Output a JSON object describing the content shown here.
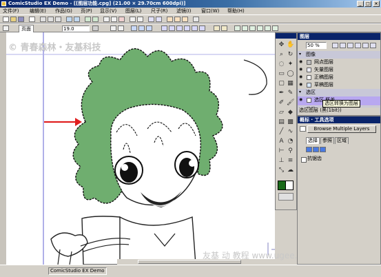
{
  "window": {
    "title": "ComicStudio EX Demo - [[图层功能.cpg] (21.00 × 29.70cm 600dpi)]",
    "minimize": "_",
    "maximize": "□",
    "close": "×"
  },
  "menu": [
    "文件(F)",
    "编辑(E)",
    "作品(G)",
    "页(P)",
    "显示(V)",
    "图层(L)",
    "尺子(R)",
    "滤镜(I)",
    "窗口(W)",
    "帮助(H)"
  ],
  "toolbar": {
    "zoom_value": "19.0",
    "page_tab": "页面"
  },
  "watermarks": {
    "top_left": "© 青春森林・友基科技",
    "bottom_right": "友基 动 教程  www.ugee.com.cn"
  },
  "layers_panel": {
    "title": "图层",
    "opacity": "50 %",
    "group_label": "图像",
    "layers": [
      "网点图层",
      "矢量图层",
      "正稿图层",
      "草稿图层"
    ],
    "selection_group": "选区",
    "selection_layer": "选区 瓶盖",
    "ruler_group": "尺子",
    "info_text": "选区图层 (黑(1bit))"
  },
  "tooltip": "选区转换为图层",
  "options_panel": {
    "title": "概标 · 工具选项",
    "browse_button": "Browse Multiple Layers",
    "tabs": [
      "选择",
      "参照",
      "区域"
    ],
    "antialias_label": "抗锯齿"
  },
  "status": {
    "text": "ComicStudio EX Demo"
  },
  "colors": {
    "selection_fill": "#6fae6f",
    "arrow": "#e02020",
    "title_gradient_start": "#0a246a"
  }
}
